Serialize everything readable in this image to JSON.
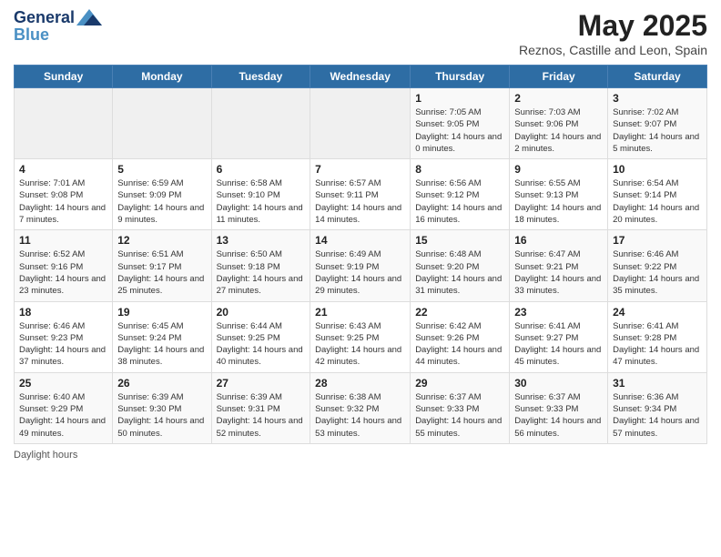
{
  "header": {
    "logo_line1": "General",
    "logo_line2": "Blue",
    "month_title": "May 2025",
    "subtitle": "Reznos, Castille and Leon, Spain"
  },
  "days_of_week": [
    "Sunday",
    "Monday",
    "Tuesday",
    "Wednesday",
    "Thursday",
    "Friday",
    "Saturday"
  ],
  "weeks": [
    [
      {
        "day": "",
        "info": ""
      },
      {
        "day": "",
        "info": ""
      },
      {
        "day": "",
        "info": ""
      },
      {
        "day": "",
        "info": ""
      },
      {
        "day": "1",
        "info": "Sunrise: 7:05 AM\nSunset: 9:05 PM\nDaylight: 14 hours and 0 minutes."
      },
      {
        "day": "2",
        "info": "Sunrise: 7:03 AM\nSunset: 9:06 PM\nDaylight: 14 hours and 2 minutes."
      },
      {
        "day": "3",
        "info": "Sunrise: 7:02 AM\nSunset: 9:07 PM\nDaylight: 14 hours and 5 minutes."
      }
    ],
    [
      {
        "day": "4",
        "info": "Sunrise: 7:01 AM\nSunset: 9:08 PM\nDaylight: 14 hours and 7 minutes."
      },
      {
        "day": "5",
        "info": "Sunrise: 6:59 AM\nSunset: 9:09 PM\nDaylight: 14 hours and 9 minutes."
      },
      {
        "day": "6",
        "info": "Sunrise: 6:58 AM\nSunset: 9:10 PM\nDaylight: 14 hours and 11 minutes."
      },
      {
        "day": "7",
        "info": "Sunrise: 6:57 AM\nSunset: 9:11 PM\nDaylight: 14 hours and 14 minutes."
      },
      {
        "day": "8",
        "info": "Sunrise: 6:56 AM\nSunset: 9:12 PM\nDaylight: 14 hours and 16 minutes."
      },
      {
        "day": "9",
        "info": "Sunrise: 6:55 AM\nSunset: 9:13 PM\nDaylight: 14 hours and 18 minutes."
      },
      {
        "day": "10",
        "info": "Sunrise: 6:54 AM\nSunset: 9:14 PM\nDaylight: 14 hours and 20 minutes."
      }
    ],
    [
      {
        "day": "11",
        "info": "Sunrise: 6:52 AM\nSunset: 9:16 PM\nDaylight: 14 hours and 23 minutes."
      },
      {
        "day": "12",
        "info": "Sunrise: 6:51 AM\nSunset: 9:17 PM\nDaylight: 14 hours and 25 minutes."
      },
      {
        "day": "13",
        "info": "Sunrise: 6:50 AM\nSunset: 9:18 PM\nDaylight: 14 hours and 27 minutes."
      },
      {
        "day": "14",
        "info": "Sunrise: 6:49 AM\nSunset: 9:19 PM\nDaylight: 14 hours and 29 minutes."
      },
      {
        "day": "15",
        "info": "Sunrise: 6:48 AM\nSunset: 9:20 PM\nDaylight: 14 hours and 31 minutes."
      },
      {
        "day": "16",
        "info": "Sunrise: 6:47 AM\nSunset: 9:21 PM\nDaylight: 14 hours and 33 minutes."
      },
      {
        "day": "17",
        "info": "Sunrise: 6:46 AM\nSunset: 9:22 PM\nDaylight: 14 hours and 35 minutes."
      }
    ],
    [
      {
        "day": "18",
        "info": "Sunrise: 6:46 AM\nSunset: 9:23 PM\nDaylight: 14 hours and 37 minutes."
      },
      {
        "day": "19",
        "info": "Sunrise: 6:45 AM\nSunset: 9:24 PM\nDaylight: 14 hours and 38 minutes."
      },
      {
        "day": "20",
        "info": "Sunrise: 6:44 AM\nSunset: 9:25 PM\nDaylight: 14 hours and 40 minutes."
      },
      {
        "day": "21",
        "info": "Sunrise: 6:43 AM\nSunset: 9:25 PM\nDaylight: 14 hours and 42 minutes."
      },
      {
        "day": "22",
        "info": "Sunrise: 6:42 AM\nSunset: 9:26 PM\nDaylight: 14 hours and 44 minutes."
      },
      {
        "day": "23",
        "info": "Sunrise: 6:41 AM\nSunset: 9:27 PM\nDaylight: 14 hours and 45 minutes."
      },
      {
        "day": "24",
        "info": "Sunrise: 6:41 AM\nSunset: 9:28 PM\nDaylight: 14 hours and 47 minutes."
      }
    ],
    [
      {
        "day": "25",
        "info": "Sunrise: 6:40 AM\nSunset: 9:29 PM\nDaylight: 14 hours and 49 minutes."
      },
      {
        "day": "26",
        "info": "Sunrise: 6:39 AM\nSunset: 9:30 PM\nDaylight: 14 hours and 50 minutes."
      },
      {
        "day": "27",
        "info": "Sunrise: 6:39 AM\nSunset: 9:31 PM\nDaylight: 14 hours and 52 minutes."
      },
      {
        "day": "28",
        "info": "Sunrise: 6:38 AM\nSunset: 9:32 PM\nDaylight: 14 hours and 53 minutes."
      },
      {
        "day": "29",
        "info": "Sunrise: 6:37 AM\nSunset: 9:33 PM\nDaylight: 14 hours and 55 minutes."
      },
      {
        "day": "30",
        "info": "Sunrise: 6:37 AM\nSunset: 9:33 PM\nDaylight: 14 hours and 56 minutes."
      },
      {
        "day": "31",
        "info": "Sunrise: 6:36 AM\nSunset: 9:34 PM\nDaylight: 14 hours and 57 minutes."
      }
    ]
  ],
  "footer": "Daylight hours"
}
